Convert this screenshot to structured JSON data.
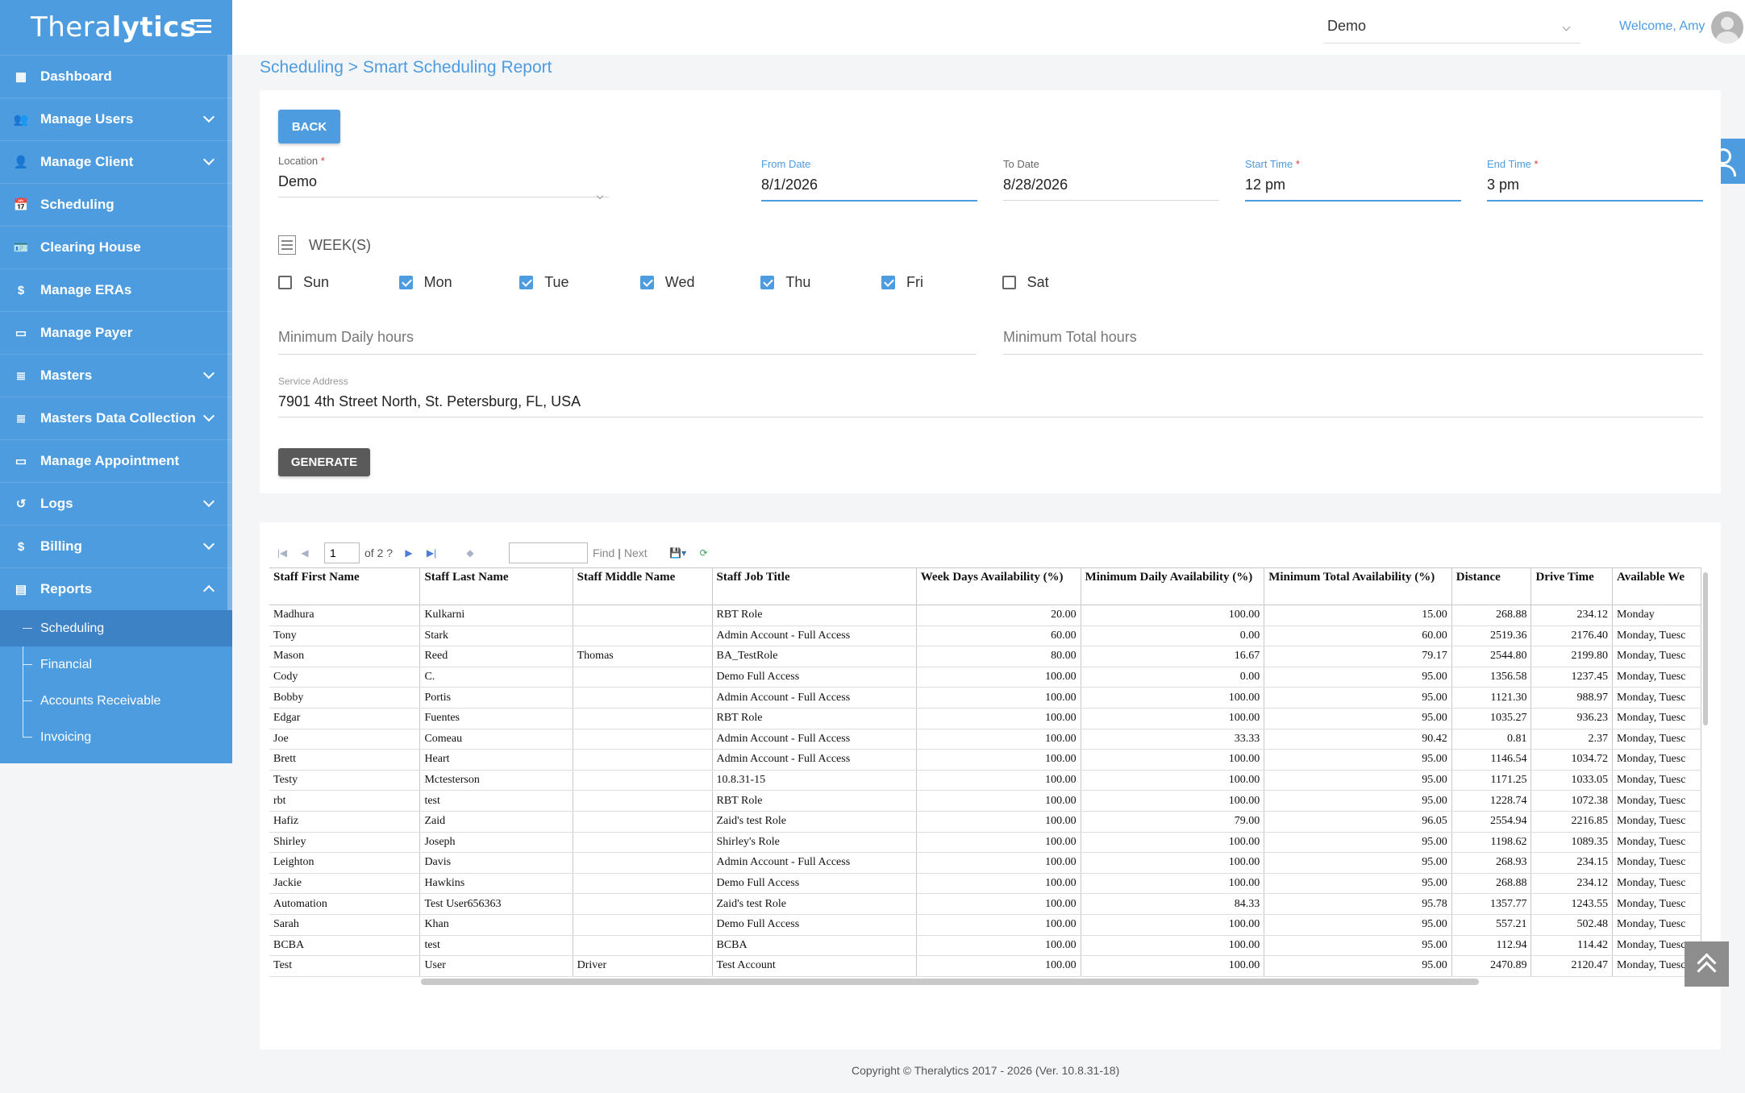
{
  "app": {
    "logo_text_1": "Thera",
    "logo_text_2": "lytics"
  },
  "header": {
    "org_select": "Demo",
    "welcome": "Welcome, Amy"
  },
  "sidebar": {
    "items": [
      {
        "label": "Dashboard",
        "icon": "dashboard-icon",
        "expandable": false
      },
      {
        "label": "Manage Users",
        "icon": "users-icon",
        "expandable": true
      },
      {
        "label": "Manage Client",
        "icon": "person-icon",
        "expandable": true
      },
      {
        "label": "Scheduling",
        "icon": "calendar-icon",
        "expandable": false
      },
      {
        "label": "Clearing House",
        "icon": "id-card-icon",
        "expandable": false
      },
      {
        "label": "Manage ERAs",
        "icon": "dollar-icon",
        "expandable": false
      },
      {
        "label": "Manage Payer",
        "icon": "card-icon",
        "expandable": false
      },
      {
        "label": "Masters",
        "icon": "database-icon",
        "expandable": true
      },
      {
        "label": "Masters Data Collection",
        "icon": "database-icon",
        "expandable": true
      },
      {
        "label": "Manage Appointment",
        "icon": "card-icon",
        "expandable": false
      },
      {
        "label": "Logs",
        "icon": "history-icon",
        "expandable": true
      },
      {
        "label": "Billing",
        "icon": "dollar-icon",
        "expandable": true
      },
      {
        "label": "Reports",
        "icon": "report-icon",
        "expandable": true,
        "expanded": true
      }
    ],
    "report_subitems": [
      "Scheduling",
      "Financial",
      "Accounts Receivable",
      "Invoicing"
    ],
    "active_subitem": "Scheduling"
  },
  "breadcrumb": {
    "parent": "Scheduling",
    "sep": " > ",
    "current": "Smart Scheduling Report"
  },
  "form": {
    "back_label": "BACK",
    "location_label": "Location",
    "location_value": "Demo",
    "from_date_label": "From Date",
    "from_date_value": "8/1/2026",
    "to_date_label": "To Date",
    "to_date_value": "8/28/2026",
    "start_time_label": "Start Time",
    "start_time_value": "12 pm",
    "end_time_label": "End Time",
    "end_time_value": "3 pm",
    "required_mark": "*",
    "weeks_label": "WEEK(S)",
    "days": [
      {
        "label": "Sun",
        "checked": false
      },
      {
        "label": "Mon",
        "checked": true
      },
      {
        "label": "Tue",
        "checked": true
      },
      {
        "label": "Wed",
        "checked": true
      },
      {
        "label": "Thu",
        "checked": true
      },
      {
        "label": "Fri",
        "checked": true
      },
      {
        "label": "Sat",
        "checked": false
      }
    ],
    "min_daily_placeholder": "Minimum Daily hours",
    "min_total_placeholder": "Minimum Total hours",
    "service_address_label": "Service Address",
    "service_address_value": "7901 4th Street North, St. Petersburg, FL, USA",
    "generate_label": "GENERATE"
  },
  "report": {
    "toolbar": {
      "page": "1",
      "of_pages": "of 2 ?",
      "find": "Find",
      "sep": "|",
      "next": "Next"
    },
    "columns": [
      "Staff First Name",
      "Staff Last Name",
      "Staff Middle Name",
      "Staff Job Title",
      "Week Days Availability (%)",
      "Minimum Daily Availability (%)",
      "Minimum Total Availability (%)",
      "Distance",
      "Drive Time",
      "Available We"
    ],
    "rows": [
      [
        "Madhura",
        "Kulkarni",
        "",
        "RBT Role",
        "20.00",
        "100.00",
        "15.00",
        "268.88",
        "234.12",
        "Monday"
      ],
      [
        "Tony",
        "Stark",
        "",
        "Admin Account - Full Access",
        "60.00",
        "0.00",
        "60.00",
        "2519.36",
        "2176.40",
        "Monday, Tuesc"
      ],
      [
        "Mason",
        "Reed",
        "Thomas",
        "BA_TestRole",
        "80.00",
        "16.67",
        "79.17",
        "2544.80",
        "2199.80",
        "Monday, Tuesc"
      ],
      [
        "Cody",
        "C.",
        "",
        "Demo Full Access",
        "100.00",
        "0.00",
        "95.00",
        "1356.58",
        "1237.45",
        "Monday, Tuesc"
      ],
      [
        "Bobby",
        "Portis",
        "",
        "Admin Account - Full Access",
        "100.00",
        "100.00",
        "95.00",
        "1121.30",
        "988.97",
        "Monday, Tuesc"
      ],
      [
        "Edgar",
        "Fuentes",
        "",
        "RBT Role",
        "100.00",
        "100.00",
        "95.00",
        "1035.27",
        "936.23",
        "Monday, Tuesc"
      ],
      [
        "Joe",
        "Comeau",
        "",
        "Admin Account - Full Access",
        "100.00",
        "33.33",
        "90.42",
        "0.81",
        "2.37",
        "Monday, Tuesc"
      ],
      [
        "Brett",
        "Heart",
        "",
        "Admin Account - Full Access",
        "100.00",
        "100.00",
        "95.00",
        "1146.54",
        "1034.72",
        "Monday, Tuesc"
      ],
      [
        "Testy",
        "Mctesterson",
        "",
        "10.8.31-15",
        "100.00",
        "100.00",
        "95.00",
        "1171.25",
        "1033.05",
        "Monday, Tuesc"
      ],
      [
        "rbt",
        "test",
        "",
        "RBT Role",
        "100.00",
        "100.00",
        "95.00",
        "1228.74",
        "1072.38",
        "Monday, Tuesc"
      ],
      [
        "Hafiz",
        "Zaid",
        "",
        "Zaid's test Role",
        "100.00",
        "79.00",
        "96.05",
        "2554.94",
        "2216.85",
        "Monday, Tuesc"
      ],
      [
        "Shirley",
        "Joseph",
        "",
        "Shirley's Role",
        "100.00",
        "100.00",
        "95.00",
        "1198.62",
        "1089.35",
        "Monday, Tuesc"
      ],
      [
        "Leighton",
        "Davis",
        "",
        "Admin Account - Full Access",
        "100.00",
        "100.00",
        "95.00",
        "268.93",
        "234.15",
        "Monday, Tuesc"
      ],
      [
        "Jackie",
        "Hawkins",
        "",
        "Demo Full Access",
        "100.00",
        "100.00",
        "95.00",
        "268.88",
        "234.12",
        "Monday, Tuesc"
      ],
      [
        "Automation",
        "Test User656363",
        "",
        "Zaid's test Role",
        "100.00",
        "84.33",
        "95.78",
        "1357.77",
        "1243.55",
        "Monday, Tuesc"
      ],
      [
        "Sarah",
        "Khan",
        "",
        "Demo Full Access",
        "100.00",
        "100.00",
        "95.00",
        "557.21",
        "502.48",
        "Monday, Tuesc"
      ],
      [
        "BCBA",
        "test",
        "",
        "BCBA",
        "100.00",
        "100.00",
        "95.00",
        "112.94",
        "114.42",
        "Monday, Tuesc"
      ],
      [
        "Test",
        "User",
        "Driver",
        "Test Account",
        "100.00",
        "100.00",
        "95.00",
        "2470.89",
        "2120.47",
        "Monday, Tuesc"
      ]
    ]
  },
  "footer": {
    "copyright": "Copyright © Theralytics 2017 - 2026 (Ver. 10.8.31-18)"
  }
}
